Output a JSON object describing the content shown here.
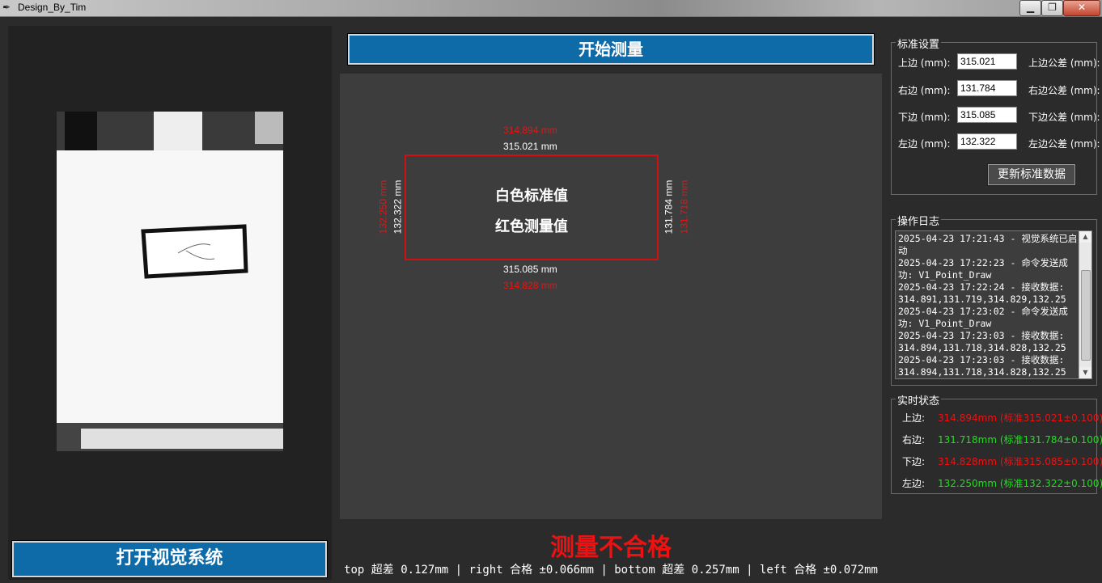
{
  "window": {
    "title": "Design_By_Tim",
    "minimize_label": "▁",
    "maximize_label": "❐",
    "close_label": "✕"
  },
  "buttons": {
    "open_vision": "打开视觉系统",
    "start_measure": "开始测量",
    "update_standard": "更新标准数据"
  },
  "canvas": {
    "top_measured": "314.894 mm",
    "top_standard": "315.021 mm",
    "bottom_standard": "315.085 mm",
    "bottom_measured": "314.828 mm",
    "left_measured": "132.250 mm",
    "left_standard": "132.322 mm",
    "right_standard": "131.784 mm",
    "right_measured": "131.718 mm",
    "legend_white": "白色标准值",
    "legend_red": "红色测量值"
  },
  "result": {
    "status": "测量不合格",
    "detail": "top 超差 0.127mm | right 合格 ±0.066mm | bottom 超差 0.257mm | left 合格 ±0.072mm"
  },
  "standard_settings": {
    "title": "标准设置",
    "fields": [
      {
        "label": "上边 (mm):",
        "value": "315.021",
        "tol_label": "上边公差 (mm):"
      },
      {
        "label": "右边 (mm):",
        "value": "131.784",
        "tol_label": "右边公差 (mm):"
      },
      {
        "label": "下边 (mm):",
        "value": "315.085",
        "tol_label": "下边公差 (mm):"
      },
      {
        "label": "左边 (mm):",
        "value": "132.322",
        "tol_label": "左边公差 (mm):"
      }
    ]
  },
  "log": {
    "title": "操作日志",
    "lines": [
      "2025-04-23 17:21:43 - 视觉系统已启动",
      "2025-04-23 17:22:23 - 命令发送成功: V1_Point_Draw",
      "2025-04-23 17:22:24 - 接收数据: 314.891,131.719,314.829,132.25",
      "2025-04-23 17:23:02 - 命令发送成功: V1_Point_Draw",
      "2025-04-23 17:23:03 - 接收数据: 314.894,131.718,314.828,132.25",
      "2025-04-23 17:23:03 - 接收数据: 314.894,131.718,314.828,132.25"
    ]
  },
  "realtime": {
    "title": "实时状态",
    "rows": [
      {
        "label": "上边:",
        "value": "314.894mm (标准315.021±0.100)",
        "status": "fail"
      },
      {
        "label": "右边:",
        "value": "131.718mm (标准131.784±0.100)",
        "status": "pass"
      },
      {
        "label": "下边:",
        "value": "314.828mm (标准315.085±0.100)",
        "status": "fail"
      },
      {
        "label": "左边:",
        "value": "132.250mm (标准132.322±0.100)",
        "status": "pass"
      }
    ]
  },
  "colors": {
    "accent_blue": "#0f6aa8",
    "fail_red": "#ee1111",
    "pass_green": "#22dd22"
  }
}
